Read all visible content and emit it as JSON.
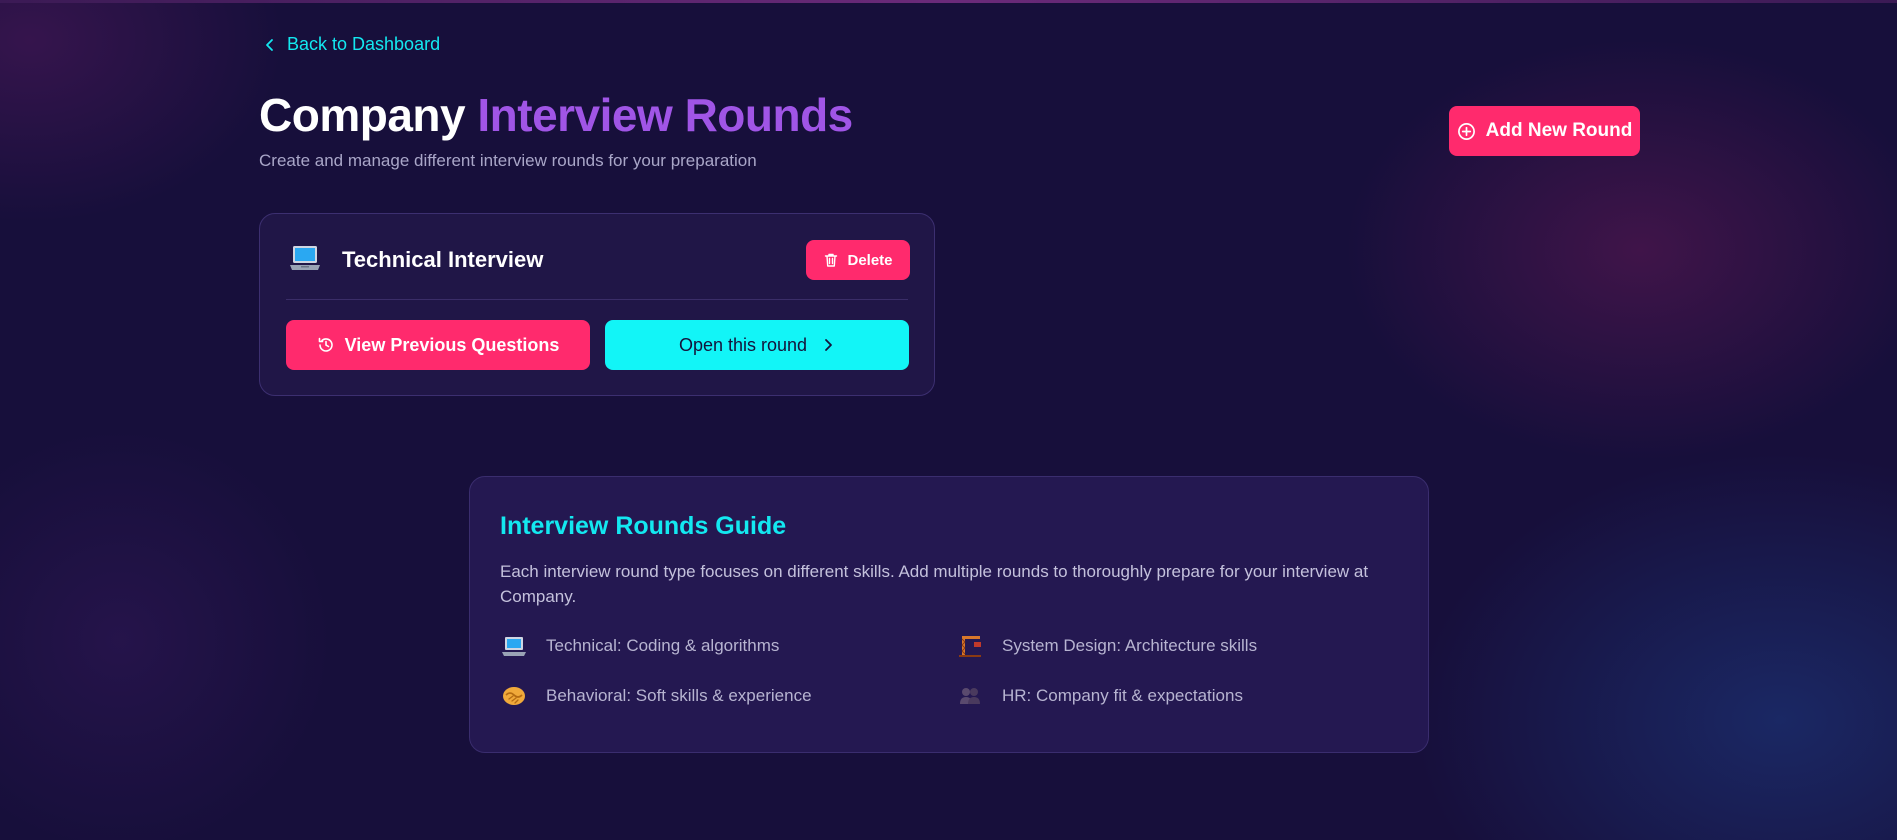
{
  "nav": {
    "back_label": "Back to Dashboard"
  },
  "header": {
    "title_part1": "Company",
    "title_part2": "Interview Rounds",
    "subtitle": "Create and manage different interview rounds for your preparation",
    "add_button": "Add New Round"
  },
  "rounds": [
    {
      "icon": "laptop-icon",
      "title": "Technical Interview",
      "delete_label": "Delete",
      "view_previous_label": "View Previous Questions",
      "open_label": "Open this round"
    }
  ],
  "guide": {
    "title": "Interview Rounds Guide",
    "description": "Each interview round type focuses on different skills. Add multiple rounds to thoroughly prepare for your interview at Company.",
    "items": [
      {
        "icon": "laptop-icon",
        "text": "Technical: Coding & algorithms"
      },
      {
        "icon": "construction-crane-icon",
        "text": "System Design: Architecture skills"
      },
      {
        "icon": "handshake-icon",
        "text": "Behavioral: Soft skills & experience"
      },
      {
        "icon": "people-silhouette-icon",
        "text": "HR: Company fit & expectations"
      }
    ]
  },
  "colors": {
    "background": "#170f3b",
    "accent_pink": "#ff2a6d",
    "accent_cyan": "#12f5f7",
    "accent_purple": "#a055e6"
  }
}
